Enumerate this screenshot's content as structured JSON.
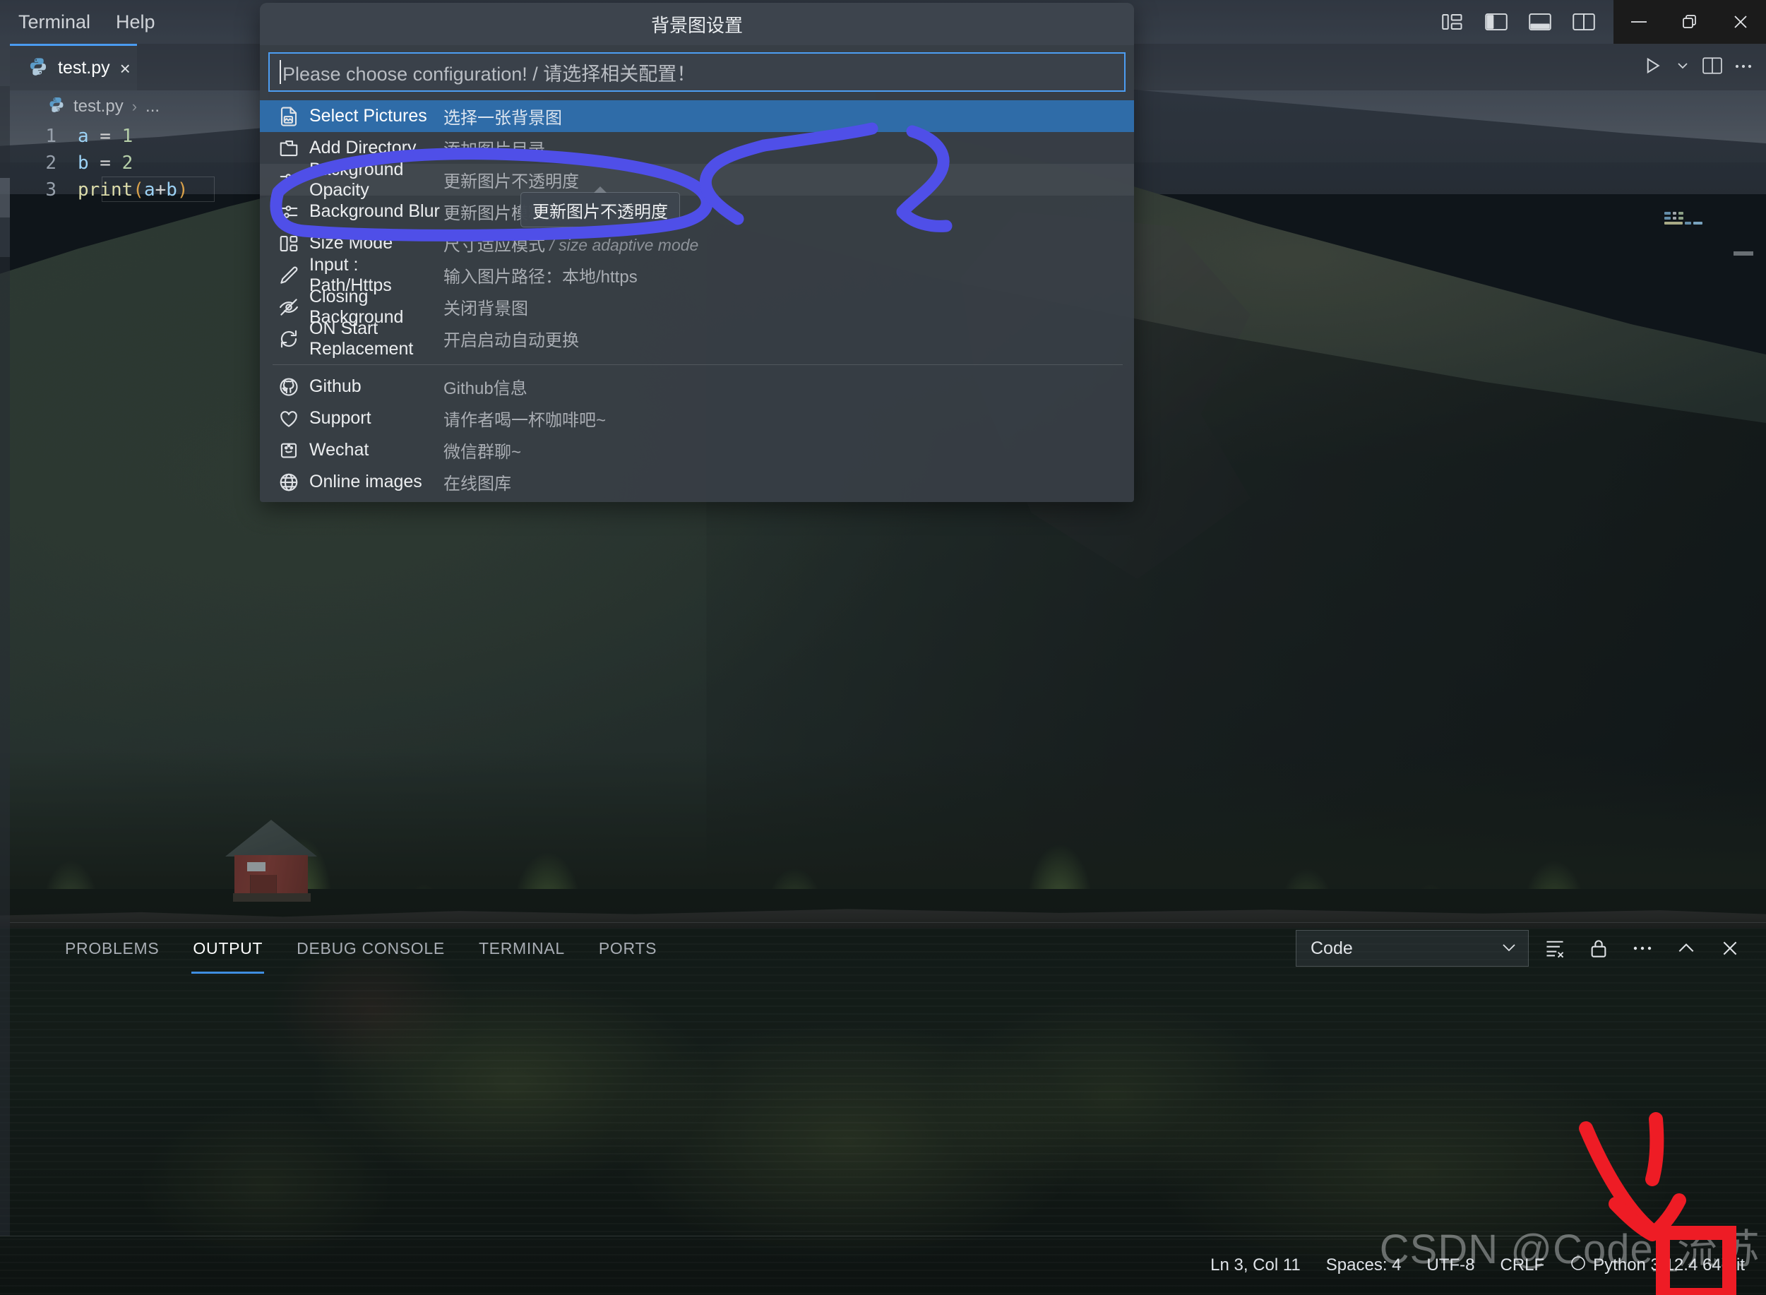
{
  "titlebar": {
    "menu": [
      "Terminal",
      "Help"
    ],
    "layout_icons": [
      "customize-layout-icon",
      "toggle-primary-sidebar-icon",
      "toggle-panel-icon",
      "toggle-secondary-sidebar-icon"
    ],
    "window_controls": [
      "minimize-icon",
      "restore-icon",
      "close-icon"
    ]
  },
  "editor": {
    "tab": {
      "filename": "test.py",
      "icon": "python-file-icon",
      "close": "×"
    },
    "actions": [
      "run-python-file-icon",
      "chevron-down-icon",
      "split-editor-icon",
      "more-actions-icon"
    ],
    "breadcrumb": {
      "icon": "python-file-icon",
      "file": "test.py",
      "separator": "›",
      "symbol": "..."
    },
    "code_lines": [
      {
        "n": "1",
        "tokens": [
          {
            "t": "a",
            "c": "k-var"
          },
          {
            "t": " = ",
            "c": "k-op"
          },
          {
            "t": "1",
            "c": "k-num"
          }
        ]
      },
      {
        "n": "2",
        "tokens": [
          {
            "t": "b",
            "c": "k-var"
          },
          {
            "t": " = ",
            "c": "k-op"
          },
          {
            "t": "2",
            "c": "k-num"
          }
        ]
      },
      {
        "n": "3",
        "tokens": [
          {
            "t": "print",
            "c": "k-fn"
          },
          {
            "t": "(",
            "c": "k-paren"
          },
          {
            "t": "a",
            "c": "k-var"
          },
          {
            "t": "+",
            "c": "k-op"
          },
          {
            "t": "b",
            "c": "k-var"
          },
          {
            "t": ")",
            "c": "k-paren"
          }
        ]
      }
    ]
  },
  "quickpick": {
    "title": "背景图设置",
    "input_placeholder": "Please choose configuration! / 请选择相关配置！",
    "input_value": "",
    "items": [
      {
        "icon": "file-image-icon",
        "label": "Select Pictures",
        "desc": "选择一张背景图",
        "state": "selected"
      },
      {
        "icon": "folder-icon",
        "label": "Add Directory",
        "desc": "添加图片目录",
        "state": "normal"
      },
      {
        "icon": "settings-sliders-icon",
        "label": "Background Opacity",
        "desc": "更新图片不透明度",
        "state": "hovered"
      },
      {
        "icon": "settings-sliders-icon",
        "label": "Background Blur",
        "desc": "更新图片模糊度",
        "state": "normal"
      },
      {
        "icon": "layout-columns-icon",
        "label": "Size Mode",
        "desc": "尺寸适应模式",
        "desc_muted": " / size adaptive mode",
        "state": "normal"
      },
      {
        "icon": "pencil-icon",
        "label": "Input : Path/Https",
        "desc": "输入图片路径：本地/https",
        "state": "normal"
      },
      {
        "icon": "eye-closed-icon",
        "label": "Closing Background",
        "desc": "关闭背景图",
        "state": "normal"
      },
      {
        "icon": "refresh-icon",
        "label": "ON Start Replacement",
        "desc": "开启启动自动更换",
        "state": "normal"
      }
    ],
    "items_secondary": [
      {
        "icon": "github-icon",
        "label": "Github",
        "desc": "Github信息",
        "state": "normal"
      },
      {
        "icon": "heart-icon",
        "label": "Support",
        "desc": "请作者喝一杯咖啡吧~",
        "state": "normal"
      },
      {
        "icon": "wechat-icon",
        "label": "Wechat",
        "desc": "微信群聊~",
        "state": "normal"
      },
      {
        "icon": "globe-icon",
        "label": "Online images",
        "desc": "在线图库",
        "state": "normal"
      }
    ],
    "tooltip": "更新图片不透明度"
  },
  "panel": {
    "tabs": [
      {
        "label": "PROBLEMS",
        "active": false
      },
      {
        "label": "OUTPUT",
        "active": true
      },
      {
        "label": "DEBUG CONSOLE",
        "active": false
      },
      {
        "label": "TERMINAL",
        "active": false
      },
      {
        "label": "PORTS",
        "active": false
      }
    ],
    "channel": "Code",
    "actions": [
      "clear-output-icon",
      "lock-scrolling-icon",
      "more-actions-icon",
      "maximize-panel-icon",
      "close-panel-icon"
    ]
  },
  "statusbar": {
    "items": [
      {
        "name": "cursor-position",
        "text": "Ln 3, Col 11"
      },
      {
        "name": "indentation",
        "text": "Spaces: 4"
      },
      {
        "name": "encoding",
        "text": "UTF-8"
      },
      {
        "name": "eol",
        "text": "CRLF"
      },
      {
        "name": "interpreter",
        "text": "Python 3.12.4 64-bit"
      }
    ]
  },
  "watermark": {
    "text": "CSDN @Code_流苏"
  },
  "annotations": {
    "circle_color": "#4f4fe8",
    "arrow_color": "#ee1c25",
    "box_color": "#ee1c25"
  }
}
